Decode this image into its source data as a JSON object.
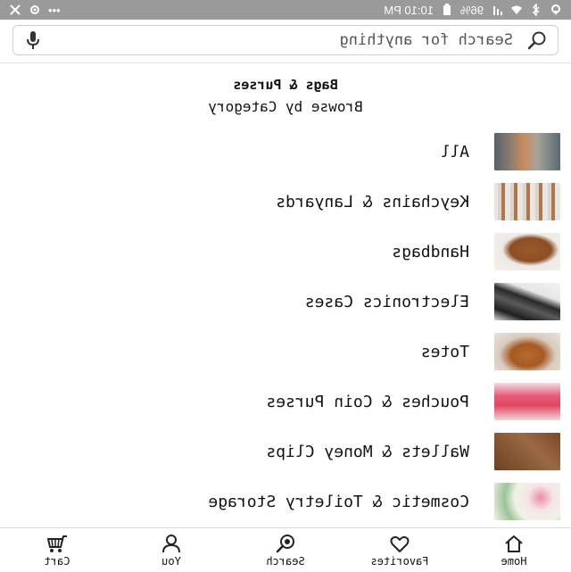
{
  "status_bar": {
    "time": "10:10 PM",
    "battery": "96%"
  },
  "search": {
    "placeholder": "Search for anything"
  },
  "header": {
    "title": "Bags & Purses",
    "subtitle": "Browse by Category"
  },
  "categories": [
    {
      "label": "All"
    },
    {
      "label": "Keychains & Lanyards"
    },
    {
      "label": "Handbags"
    },
    {
      "label": "Electronics Cases"
    },
    {
      "label": "Totes"
    },
    {
      "label": "Pouches & Coin Purses"
    },
    {
      "label": "Wallets & Money Clips"
    },
    {
      "label": "Cosmetic & Toiletry Storage"
    }
  ],
  "bottom_nav": {
    "home": "Home",
    "favorites": "Favorites",
    "search": "Search",
    "you": "You",
    "cart": "Cart"
  }
}
